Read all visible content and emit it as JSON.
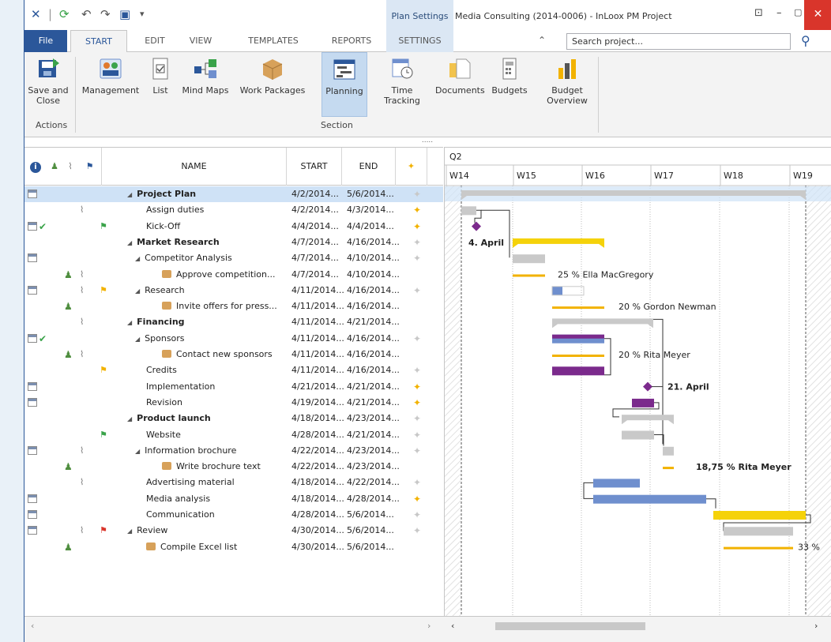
{
  "window": {
    "title": "Media Consulting (2014-0006) - InLoox PM Project",
    "context_tab": "Plan Settings"
  },
  "tabs": [
    "File",
    "START",
    "EDIT",
    "VIEW",
    "TEMPLATES",
    "REPORTS",
    "SETTINGS"
  ],
  "search": {
    "value": "Search project..."
  },
  "ribbon": {
    "buttons": [
      {
        "label": "Save and Close",
        "icon": "save-close-icon"
      },
      {
        "label": "Management",
        "icon": "management-icon"
      },
      {
        "label": "List",
        "icon": "list-icon"
      },
      {
        "label": "Mind Maps",
        "icon": "mind-maps-icon"
      },
      {
        "label": "Work Packages",
        "icon": "work-packages-icon"
      },
      {
        "label": "Planning",
        "icon": "planning-icon"
      },
      {
        "label": "Time Tracking",
        "icon": "time-tracking-icon"
      },
      {
        "label": "Documents",
        "icon": "documents-icon"
      },
      {
        "label": "Budgets",
        "icon": "budgets-icon"
      },
      {
        "label": "Budget Overview",
        "icon": "budget-overview-icon"
      }
    ],
    "groups": {
      "actions": "Actions",
      "section": "Section"
    }
  },
  "grid": {
    "columns": {
      "name": "NAME",
      "start": "START",
      "end": "END"
    },
    "rows": [
      {
        "name": "Project Plan",
        "start": "4/2/2014...",
        "end": "5/6/2014..."
      },
      {
        "name": "Assign duties",
        "start": "4/2/2014...",
        "end": "4/3/2014..."
      },
      {
        "name": "Kick-Off",
        "start": "4/4/2014...",
        "end": "4/4/2014..."
      },
      {
        "name": "Market Research",
        "start": "4/7/2014...",
        "end": "4/16/2014..."
      },
      {
        "name": "Competitor Analysis",
        "start": "4/7/2014...",
        "end": "4/10/2014..."
      },
      {
        "name": "Approve competition...",
        "start": "4/7/2014...",
        "end": "4/10/2014..."
      },
      {
        "name": "Research",
        "start": "4/11/2014...",
        "end": "4/16/2014..."
      },
      {
        "name": "Invite offers for press...",
        "start": "4/11/2014...",
        "end": "4/16/2014..."
      },
      {
        "name": "Financing",
        "start": "4/11/2014...",
        "end": "4/21/2014..."
      },
      {
        "name": "Sponsors",
        "start": "4/11/2014...",
        "end": "4/16/2014..."
      },
      {
        "name": "Contact new sponsors",
        "start": "4/11/2014...",
        "end": "4/16/2014..."
      },
      {
        "name": "Credits",
        "start": "4/11/2014...",
        "end": "4/16/2014..."
      },
      {
        "name": "Implementation",
        "start": "4/21/2014...",
        "end": "4/21/2014..."
      },
      {
        "name": "Revision",
        "start": "4/19/2014...",
        "end": "4/21/2014..."
      },
      {
        "name": "Product launch",
        "start": "4/18/2014...",
        "end": "4/23/2014..."
      },
      {
        "name": "Website",
        "start": "4/28/2014...",
        "end": "4/21/2014..."
      },
      {
        "name": "Information brochure",
        "start": "4/22/2014...",
        "end": "4/23/2014..."
      },
      {
        "name": "Write brochure text",
        "start": "4/22/2014...",
        "end": "4/23/2014..."
      },
      {
        "name": "Advertising material",
        "start": "4/18/2014...",
        "end": "4/22/2014..."
      },
      {
        "name": "Media analysis",
        "start": "4/18/2014...",
        "end": "4/28/2014..."
      },
      {
        "name": "Communication",
        "start": "4/28/2014...",
        "end": "5/6/2014..."
      },
      {
        "name": "Review",
        "start": "4/30/2014...",
        "end": "5/6/2014..."
      },
      {
        "name": "Compile Excel list",
        "start": "4/30/2014...",
        "end": "5/6/2014..."
      }
    ]
  },
  "gantt": {
    "quarter": "Q2",
    "weeks": [
      "W14",
      "W15",
      "W16",
      "W17",
      "W18",
      "W19"
    ],
    "labels": [
      "4. April",
      "25 % Ella MacGregory",
      "20 % Gordon Newman",
      "20 % Rita Meyer",
      "21. April",
      "18,75 % Rita Meyer",
      "33 %"
    ]
  },
  "colors": {
    "accent": "#2b579a",
    "milestone": "#7b2a8c",
    "task_yellow": "#f5d20a",
    "task_blue": "#6f8fce",
    "task_purple": "#7b2a8c",
    "task_gray": "#c9c9c9",
    "progress": "#f2b200",
    "close": "#d9352b"
  }
}
